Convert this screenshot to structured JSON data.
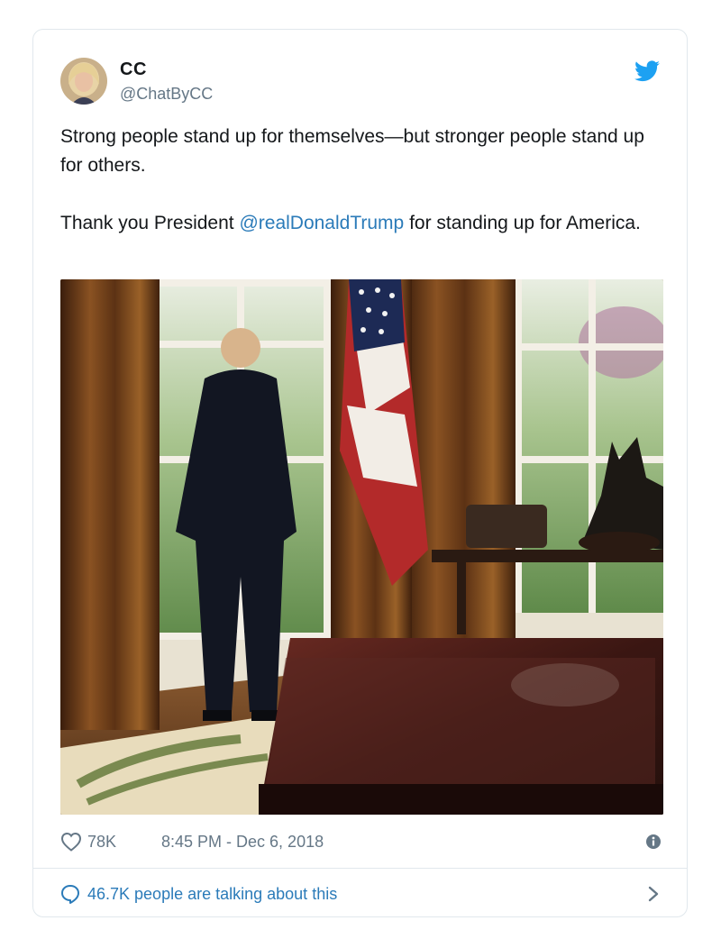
{
  "tweet": {
    "display_name": "CC",
    "handle": "@ChatByCC",
    "text_line1": "Strong people stand up for themselves—but stronger people stand up for others.",
    "text_line2_prefix": "Thank you President ",
    "mention": "@realDonaldTrump",
    "text_line2_suffix": " for standing up for America.",
    "likes": "78K",
    "timestamp": "8:45 PM - Dec 6, 2018",
    "talking": "46.7K people are talking about this"
  },
  "colors": {
    "link": "#2b7bb9",
    "twitter_blue": "#1da1f2",
    "muted": "#657786",
    "border": "#e1e8ed"
  },
  "icons": [
    "twitter-bird-icon",
    "heart-icon",
    "info-icon",
    "speech-bubble-icon",
    "chevron-right-icon"
  ]
}
